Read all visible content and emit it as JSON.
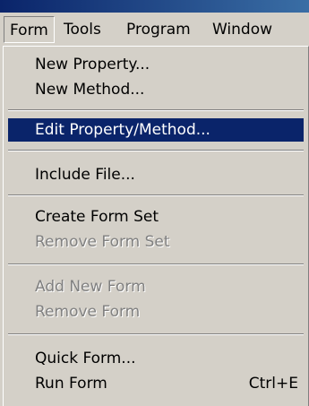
{
  "menubar": {
    "items": [
      {
        "label": "Form"
      },
      {
        "label": "Tools"
      },
      {
        "label": "Program"
      },
      {
        "label": "Window"
      }
    ]
  },
  "form_menu": {
    "new_property": "New Property...",
    "new_method": "New Method...",
    "edit_property_method": "Edit Property/Method...",
    "include_file": "Include File...",
    "create_form_set": "Create Form Set",
    "remove_form_set": "Remove Form Set",
    "add_new_form": "Add New Form",
    "remove_form": "Remove Form",
    "quick_form": "Quick Form...",
    "run_form": "Run Form",
    "run_form_shortcut": "Ctrl+E"
  },
  "colors": {
    "menu_bg": "#d4d0c8",
    "highlight": "#0a246a",
    "disabled": "#808080"
  }
}
